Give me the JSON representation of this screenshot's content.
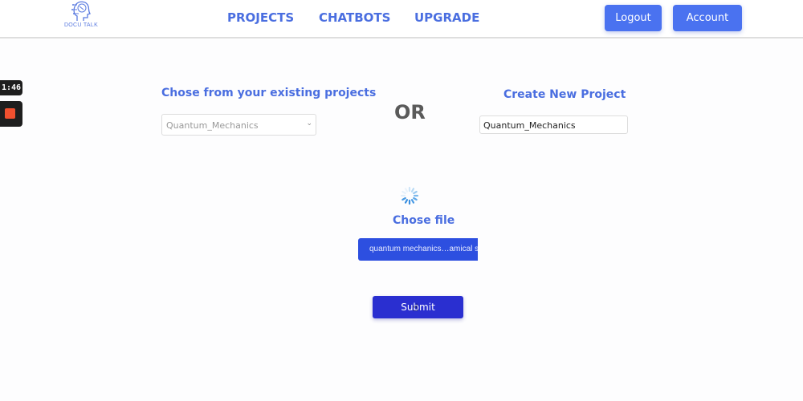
{
  "header": {
    "logo_text": "DOCU TALK",
    "nav": [
      "PROJECTS",
      "CHATBOTS",
      "UPGRADE"
    ],
    "logout_label": "Logout",
    "account_label": "Account"
  },
  "recorder": {
    "time": "1:46"
  },
  "existing": {
    "heading": "Chose from your existing projects",
    "selected": "Quantum_Mechanics"
  },
  "or_label": "OR",
  "create": {
    "heading": "Create New Project",
    "value": "Quantum_Mechanics"
  },
  "upload": {
    "heading": "Chose file",
    "file_label": "quantum mechanics…amical sy"
  },
  "submit_label": "Submit",
  "colors": {
    "accent": "#4a6ee0",
    "button": "#4a72f0",
    "submit": "#2a2fd0",
    "file_button": "#2d4fe0"
  }
}
